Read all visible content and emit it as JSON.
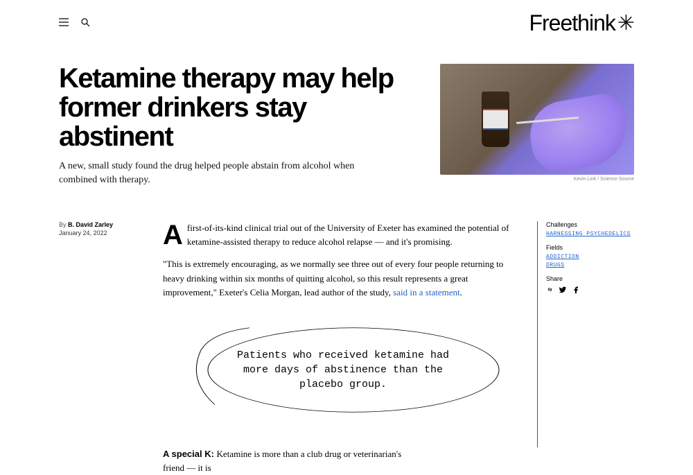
{
  "logo": "Freethink",
  "hero": {
    "title": "Ketamine therapy may help former drinkers stay abstinent",
    "subtitle": "A new, small study found the drug helped people abstain from alcohol when combined with therapy.",
    "image_credit": "Kevin Link / Science Source"
  },
  "byline": {
    "by": "By ",
    "author": "B. David Zarley",
    "date": "January 24, 2022"
  },
  "body": {
    "dropcap": "A",
    "p1_rest": "first-of-its-kind clinical trial out of the University of Exeter has examined the potential of ketamine-assisted therapy to reduce alcohol relapse — and it's promising.",
    "p2_text": "\"This is extremely encouraging, as we normally see three out of every four people returning to heavy drinking within six months of quitting alcohol, so this result represents a great improvement,\" Exeter's Celia Morgan, lead author of the study, ",
    "p2_link": "said in a statement",
    "p2_after": "."
  },
  "pullquote": "Patients who received ketamine had more days of abstinence than the placebo group.",
  "continued": {
    "heading": "A special K: ",
    "text": "Ketamine is more than a club drug or veterinarian's friend — it is"
  },
  "sidebar": {
    "challenges_label": "Challenges",
    "challenges_tag": "HARNESSING PSYCHEDELICS",
    "fields_label": "Fields",
    "fields_tags": [
      "ADDICTION",
      "DRUGS"
    ],
    "share_label": "Share"
  }
}
